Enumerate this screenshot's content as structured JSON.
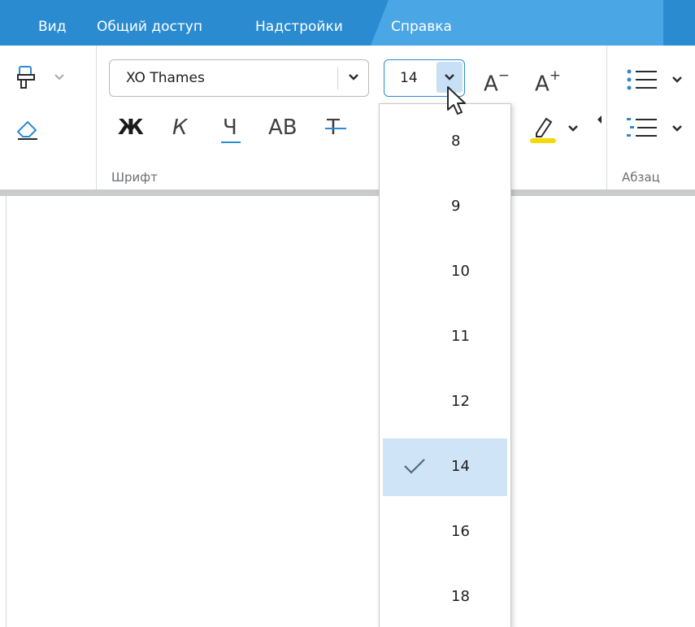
{
  "menu": {
    "items": [
      {
        "label": "Вид"
      },
      {
        "label": "Общий доступ"
      },
      {
        "label": "Надстройки"
      },
      {
        "label": "Справка"
      }
    ],
    "active_index": 3
  },
  "ribbon": {
    "font_group": {
      "label": "Шрифт",
      "font_name": "XO Thames",
      "font_size": "14",
      "bold_label": "Ж",
      "italic_label": "К",
      "underline_label": "Ч",
      "caps_label": "АВ",
      "strike_label": "Т",
      "grow_label": "A",
      "grow_mark": "+",
      "shrink_label": "A",
      "shrink_mark": "−"
    },
    "paragraph_group": {
      "label": "Абзац"
    }
  },
  "font_size_dropdown": {
    "options": [
      "8",
      "9",
      "10",
      "11",
      "12",
      "14",
      "16",
      "18"
    ],
    "selected": "14"
  },
  "colors": {
    "menubar": "#2b8bd1",
    "menubar_active": "#4ba6e5",
    "accent": "#2b8bd1",
    "selected_item": "#cfe4f6",
    "highlight_marker": "#f5d90a"
  }
}
